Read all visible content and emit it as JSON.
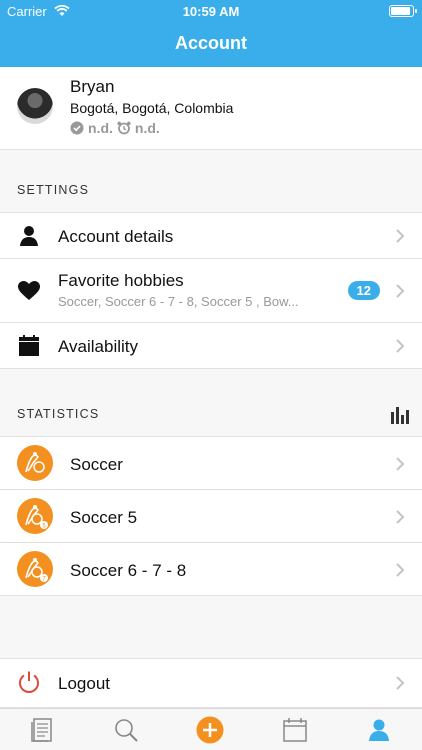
{
  "status_bar": {
    "carrier": "Carrier",
    "time": "10:59 AM"
  },
  "header": {
    "title": "Account"
  },
  "profile": {
    "name": "Bryan",
    "location": "Bogotá, Bogotá, Colombia",
    "meta_value_1": "n.d.",
    "meta_value_2": "n.d."
  },
  "settings": {
    "section_label": "SETTINGS",
    "items": [
      {
        "label": "Account details"
      },
      {
        "label": "Favorite hobbies",
        "subtitle": "Soccer, Soccer 6 - 7 - 8, Soccer 5 , Bow...",
        "badge": "12"
      },
      {
        "label": "Availability"
      }
    ]
  },
  "statistics": {
    "section_label": "STATISTICS",
    "items": [
      {
        "label": "Soccer"
      },
      {
        "label": "Soccer 5"
      },
      {
        "label": "Soccer 6 - 7 - 8"
      }
    ]
  },
  "logout": {
    "label": "Logout"
  },
  "colors": {
    "accent": "#3aaeea",
    "sport": "#f39020",
    "logout_icon": "#e04a3a"
  },
  "tabbar": {
    "tabs": [
      "news-icon",
      "search-icon",
      "add-icon",
      "calendar-icon",
      "account-icon"
    ],
    "selected": "account-icon"
  }
}
